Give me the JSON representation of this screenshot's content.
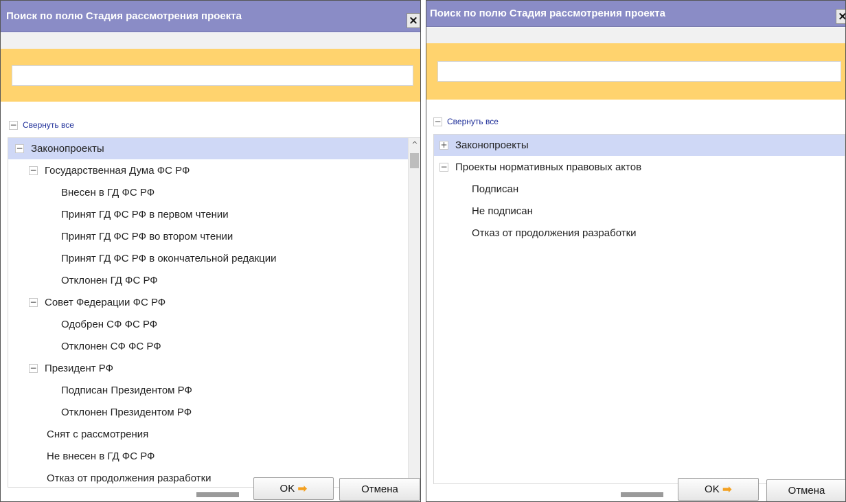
{
  "icons": {
    "close": "×",
    "expanded": "−",
    "collapsed": "+",
    "scroll_up": "^",
    "ok_arrow": "➡"
  },
  "dialogs": [
    {
      "title": "Поиск по полю Стадия рассмотрения проекта",
      "search": {
        "value": "",
        "placeholder": ""
      },
      "collapse_all_label": "Свернуть все",
      "tree": [
        "Законопроекты",
        "Государственная Дума ФС РФ",
        "Внесен в ГД ФС РФ",
        "Принят ГД ФС РФ в первом чтении",
        "Принят ГД ФС РФ во втором чтении",
        "Принят ГД ФС РФ в окончательной редакции",
        "Отклонен ГД ФС РФ",
        "Совет Федерации ФС РФ",
        "Одобрен СФ ФС РФ",
        "Отклонен СФ ФС РФ",
        "Президент РФ",
        "Подписан Президентом РФ",
        "Отклонен Президентом РФ",
        "Снят с рассмотрения",
        "Не внесен в ГД ФС РФ",
        "Отказ от продолжения разработки"
      ],
      "ok_label": "OK",
      "cancel_label": "Отмена"
    },
    {
      "title": "Поиск по полю Стадия рассмотрения проекта",
      "search": {
        "value": "",
        "placeholder": ""
      },
      "collapse_all_label": "Свернуть все",
      "tree": [
        "Законопроекты",
        "Проекты нормативных правовых актов",
        "Подписан",
        "Не подписан",
        "Отказ от продолжения разработки"
      ],
      "ok_label": "OK",
      "cancel_label": "Отмена"
    }
  ]
}
